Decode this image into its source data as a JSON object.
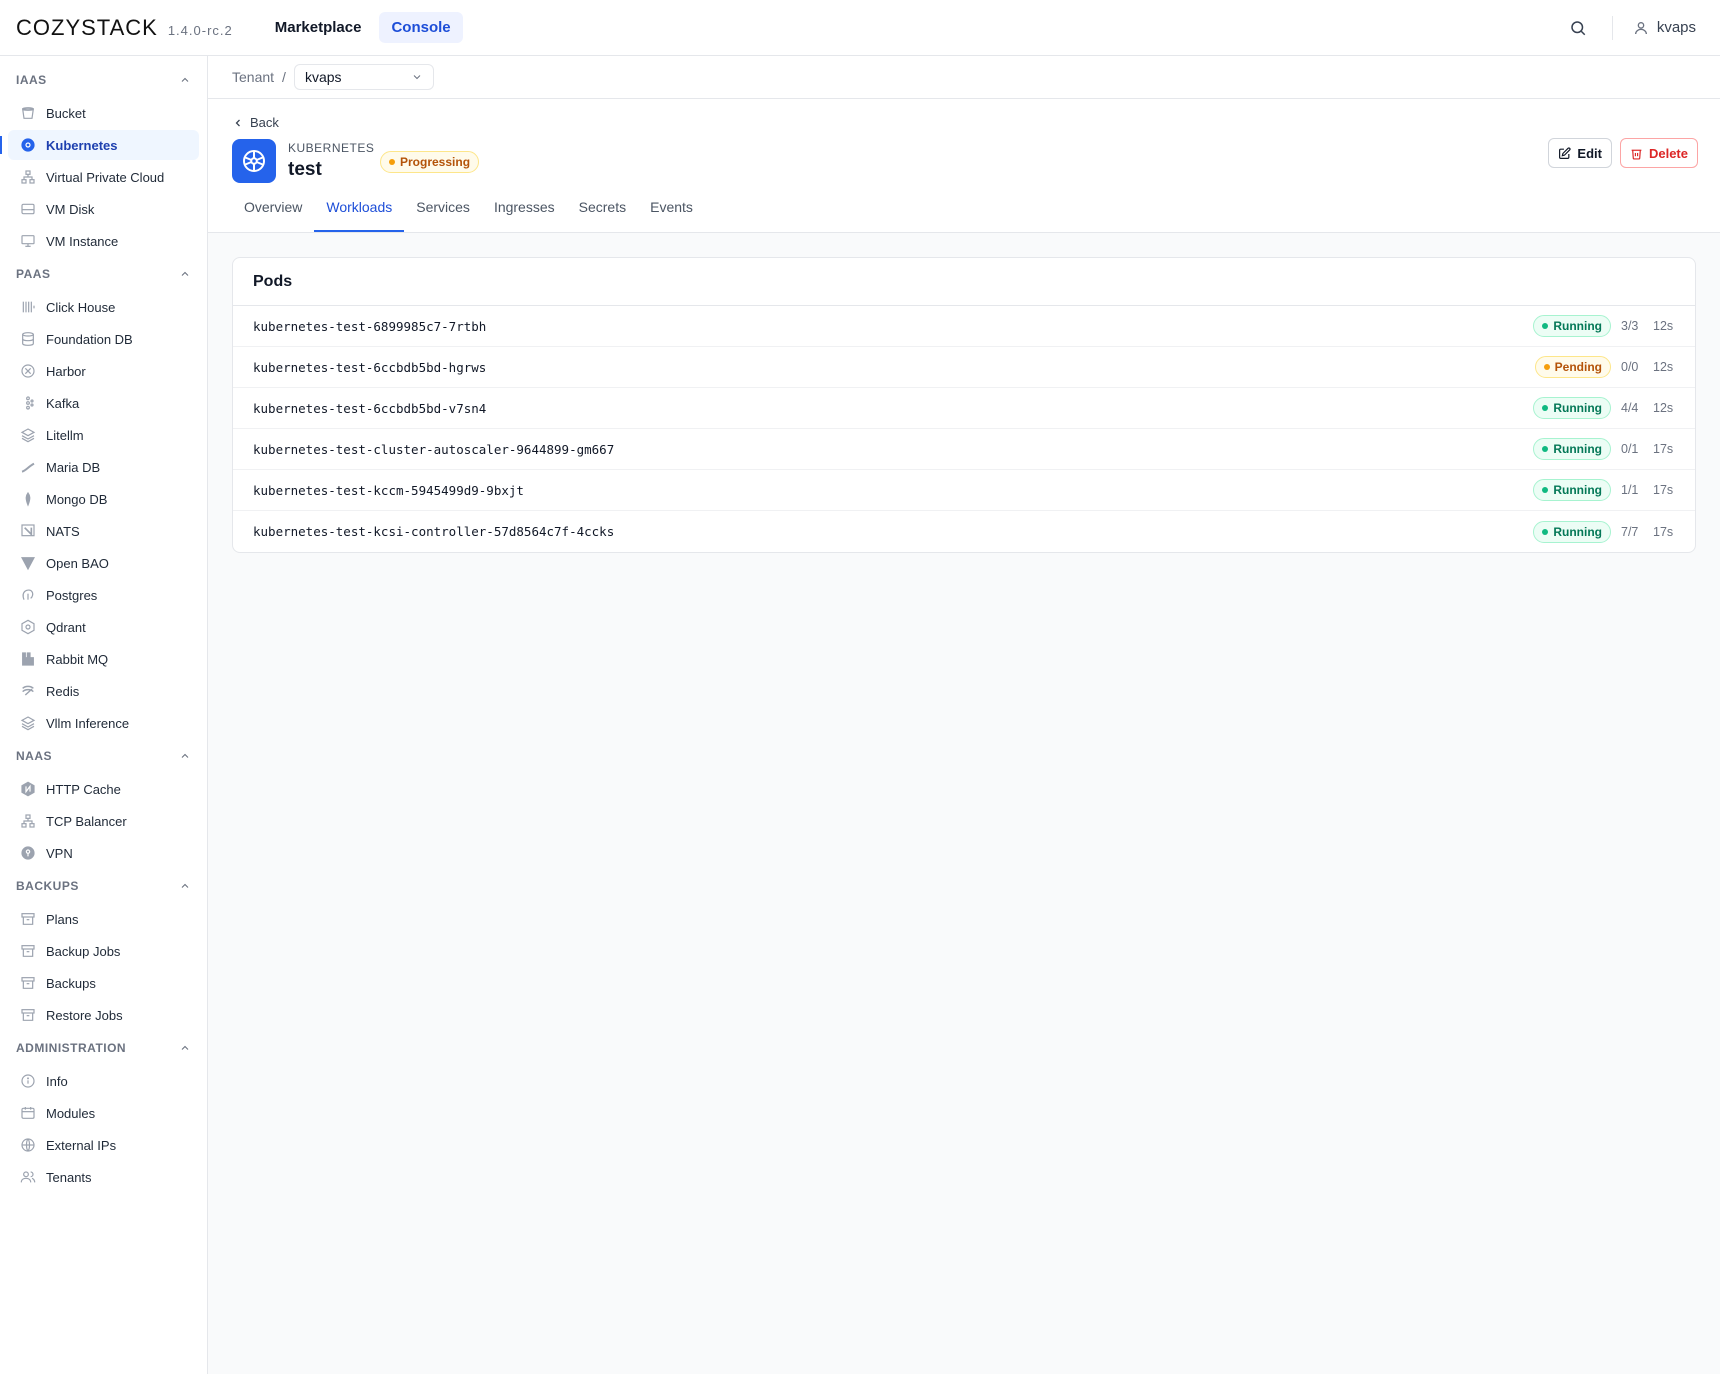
{
  "header": {
    "logo": "COZYSTACK",
    "version": "1.4.0-rc.2",
    "nav": [
      {
        "label": "Marketplace"
      },
      {
        "label": "Console"
      }
    ],
    "user": "kvaps"
  },
  "sidebar": {
    "sections": [
      {
        "title": "IAAS",
        "items": [
          "Bucket",
          "Kubernetes",
          "Virtual Private Cloud",
          "VM Disk",
          "VM Instance"
        ]
      },
      {
        "title": "PAAS",
        "items": [
          "Click House",
          "Foundation DB",
          "Harbor",
          "Kafka",
          "Litellm",
          "Maria DB",
          "Mongo DB",
          "NATS",
          "Open BAO",
          "Postgres",
          "Qdrant",
          "Rabbit MQ",
          "Redis",
          "Vllm Inference"
        ]
      },
      {
        "title": "NAAS",
        "items": [
          "HTTP Cache",
          "TCP Balancer",
          "VPN"
        ]
      },
      {
        "title": "BACKUPS",
        "items": [
          "Plans",
          "Backup Jobs",
          "Backups",
          "Restore Jobs"
        ]
      },
      {
        "title": "ADMINISTRATION",
        "items": [
          "Info",
          "Modules",
          "External IPs",
          "Tenants"
        ]
      }
    ]
  },
  "breadcrumb": {
    "label": "Tenant",
    "separator": "/",
    "tenant": "kvaps"
  },
  "resource": {
    "back": "Back",
    "kind": "KUBERNETES",
    "name": "test",
    "status": "Progressing",
    "edit": "Edit",
    "delete": "Delete"
  },
  "tabs": [
    "Overview",
    "Workloads",
    "Services",
    "Ingresses",
    "Secrets",
    "Events"
  ],
  "pods": {
    "title": "Pods",
    "rows": [
      {
        "name": "kubernetes-test-6899985c7-7rtbh",
        "status": "Running",
        "ready": "3/3",
        "age": "12s"
      },
      {
        "name": "kubernetes-test-6ccbdb5bd-hgrws",
        "status": "Pending",
        "ready": "0/0",
        "age": "12s"
      },
      {
        "name": "kubernetes-test-6ccbdb5bd-v7sn4",
        "status": "Running",
        "ready": "4/4",
        "age": "12s"
      },
      {
        "name": "kubernetes-test-cluster-autoscaler-9644899-gm667",
        "status": "Running",
        "ready": "0/1",
        "age": "17s"
      },
      {
        "name": "kubernetes-test-kccm-5945499d9-9bxjt",
        "status": "Running",
        "ready": "1/1",
        "age": "17s"
      },
      {
        "name": "kubernetes-test-kcsi-controller-57d8564c7f-4ccks",
        "status": "Running",
        "ready": "7/7",
        "age": "17s"
      }
    ]
  },
  "colors": {
    "accent": "#2563eb",
    "running": "#10b981",
    "pending": "#f59e0b",
    "danger": "#dc2626"
  }
}
